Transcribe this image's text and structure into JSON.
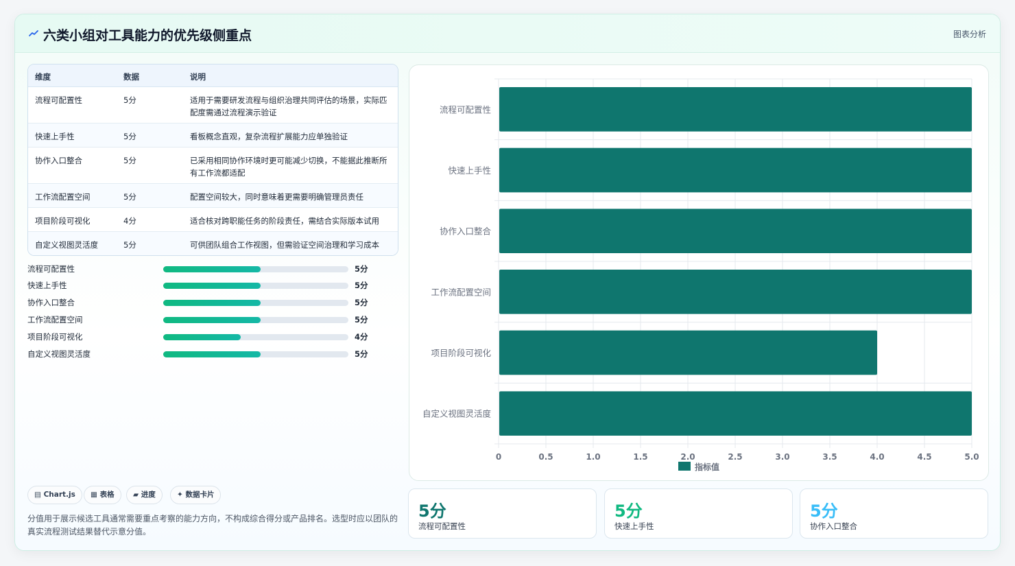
{
  "header": {
    "title": "六类小组对工具能力的优先级侧重点",
    "action": "图表分析"
  },
  "table": {
    "columns": [
      "维度",
      "数据",
      "说明"
    ],
    "rows": [
      {
        "dim": "流程可配置性",
        "value": "5分",
        "desc": "适用于需要研发流程与组织治理共同评估的场景，实际匹配度需通过流程演示验证"
      },
      {
        "dim": "快速上手性",
        "value": "5分",
        "desc": "看板概念直观，复杂流程扩展能力应单独验证"
      },
      {
        "dim": "协作入口整合",
        "value": "5分",
        "desc": "已采用相同协作环境时更可能减少切换，不能据此推断所有工作流都适配"
      },
      {
        "dim": "工作流配置空间",
        "value": "5分",
        "desc": "配置空间较大，同时意味着更需要明确管理员责任"
      },
      {
        "dim": "项目阶段可视化",
        "value": "4分",
        "desc": "适合核对跨职能任务的阶段责任，需结合实际版本试用"
      },
      {
        "dim": "自定义视图灵活度",
        "value": "5分",
        "desc": "可供团队组合工作视图，但需验证空间治理和学习成本"
      }
    ]
  },
  "progress": [
    {
      "label": "流程可配置性",
      "value_text": "5分",
      "fraction": 0.525
    },
    {
      "label": "快速上手性",
      "value_text": "5分",
      "fraction": 0.525
    },
    {
      "label": "协作入口整合",
      "value_text": "5分",
      "fraction": 0.525
    },
    {
      "label": "工作流配置空间",
      "value_text": "5分",
      "fraction": 0.525
    },
    {
      "label": "项目阶段可视化",
      "value_text": "4分",
      "fraction": 0.42
    },
    {
      "label": "自定义视图灵活度",
      "value_text": "5分",
      "fraction": 0.525
    }
  ],
  "tags": [
    {
      "icon": "chart-icon",
      "glyph": "▤",
      "label": "Chart.js"
    },
    {
      "icon": "table-icon",
      "glyph": "▦",
      "label": "表格"
    },
    {
      "icon": "progress-icon",
      "glyph": "▰",
      "label": "进度"
    },
    {
      "icon": "card-icon",
      "glyph": "✦",
      "label": "数据卡片"
    }
  ],
  "note": "分值用于展示候选工具通常需要重点考察的能力方向，不构成综合得分或产品排名。选型时应以团队的真实流程测试结果替代示意分值。",
  "kpis": [
    {
      "value": "5分",
      "label": "流程可配置性",
      "color": "#0f766e"
    },
    {
      "value": "5分",
      "label": "快速上手性",
      "color": "#10b981"
    },
    {
      "value": "5分",
      "label": "协作入口整合",
      "color": "#38bdf8"
    }
  ],
  "colors": {
    "bar": "#0f766e",
    "accent": "#10b981"
  },
  "chart_data": {
    "type": "bar",
    "orientation": "horizontal",
    "categories": [
      "流程可配置性",
      "快速上手性",
      "协作入口整合",
      "工作流配置空间",
      "项目阶段可视化",
      "自定义视图灵活度"
    ],
    "series": [
      {
        "name": "指标值",
        "values": [
          5,
          5,
          5,
          5,
          4,
          5
        ],
        "color": "#0f766e"
      }
    ],
    "xlim": [
      0,
      5
    ],
    "xticks": [
      "0",
      "0.5",
      "1.0",
      "1.5",
      "2.0",
      "2.5",
      "3.0",
      "3.5",
      "4.0",
      "4.5",
      "5.0"
    ],
    "grid": true,
    "legend": "bottom"
  }
}
